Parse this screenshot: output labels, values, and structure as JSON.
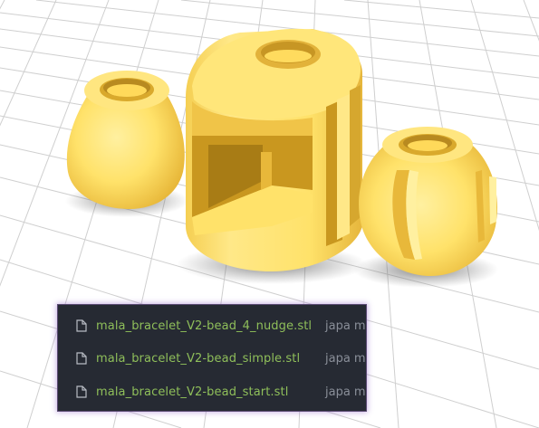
{
  "viewport": {
    "colors": {
      "background": "#ffffff",
      "grid": "#c9c9c9",
      "model_fill": "#ffe26a",
      "model_shade": "#f2c94a",
      "model_dark": "#d9a92c",
      "shadow": "#6b6b6b"
    }
  },
  "file_list": {
    "colors": {
      "panel_bg": "#262a33",
      "file_name": "#8fbf5a",
      "folder": "#8a8f99",
      "border_glow": "#8c5ac8"
    },
    "files": [
      {
        "name": "mala_bracelet_V2-bead_4_nudge.stl",
        "folder": "japa ma",
        "icon": "file-icon"
      },
      {
        "name": "mala_bracelet_V2-bead_simple.stl",
        "folder": "japa ma",
        "icon": "file-icon"
      },
      {
        "name": "mala_bracelet_V2-bead_start.stl",
        "folder": "japa ma",
        "icon": "file-icon"
      }
    ]
  }
}
